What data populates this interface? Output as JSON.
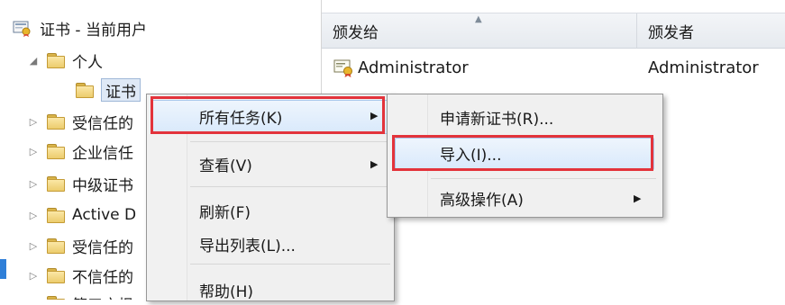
{
  "tree": {
    "root_label": "证书 - 当前用户",
    "personal_label": "个人",
    "certificates_label": "证书",
    "items": [
      {
        "label": "受信任的"
      },
      {
        "label": "企业信任"
      },
      {
        "label": "中级证书"
      },
      {
        "label": "Active D"
      },
      {
        "label": "受信任的"
      },
      {
        "label": "不信任的"
      },
      {
        "label": "第三方根"
      }
    ]
  },
  "list": {
    "columns": [
      "颁发给",
      "颁发者"
    ],
    "rows": [
      {
        "issued_to": "Administrator",
        "issued_by": "Administrator"
      }
    ]
  },
  "context_menu": {
    "items": [
      {
        "label": "所有任务(K)"
      },
      {
        "label": "查看(V)"
      },
      {
        "label": "刷新(F)"
      },
      {
        "label": "导出列表(L)..."
      },
      {
        "label": "帮助(H)"
      }
    ]
  },
  "submenu": {
    "items": [
      {
        "label": "申请新证书(R)..."
      },
      {
        "label": "导入(I)..."
      },
      {
        "label": "高级操作(A)"
      }
    ]
  },
  "colors": {
    "highlight_border": "#e3333b",
    "hover": "#d9e9fb",
    "accent": "#2f7fd8"
  },
  "icons": [
    "certificate-store-icon",
    "folder-icon",
    "certificate-icon",
    "expand-arrow-icon",
    "submenu-arrow-icon"
  ]
}
